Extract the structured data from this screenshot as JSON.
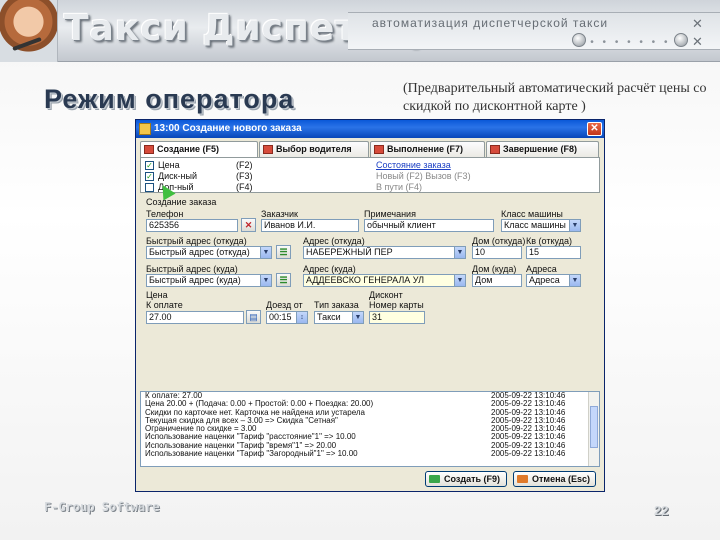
{
  "header": {
    "app_title": "Такси Диспетчер",
    "tagline": "автоматизация диспетчерской такси",
    "dots": "• • • • • • • • •"
  },
  "slide": {
    "mode_title": "Режим оператора",
    "note": "(Предварительный автоматический расчёт цены со скидкой по дисконтной карте )",
    "brand": "F-Group Software",
    "page": "22"
  },
  "window": {
    "title": "13:00 Создание нового заказа",
    "close_glyph": "✕",
    "tabs": [
      {
        "label": "Создание (F5)"
      },
      {
        "label": "Выбор водителя (F6)"
      },
      {
        "label": "Выполнение (F7)"
      },
      {
        "label": "Завершение (F8)"
      }
    ],
    "options": [
      {
        "label": "Цена",
        "key": "(F2)",
        "checked": true
      },
      {
        "label": "Диск-ный",
        "key": "(F3)",
        "checked": true
      },
      {
        "label": "Доп-ный",
        "key": "(F4)",
        "checked": false
      }
    ],
    "links": [
      "Состояние заказа",
      "Новый (F2) Вызов (F3)",
      "В пути (F4)"
    ],
    "group_label": "Создание заказа",
    "fields": {
      "phone_label": "Телефон",
      "phone_value": "625356",
      "customer_label": "Заказчик",
      "customer_value": "Иванов И.И.",
      "note_label": "Примечания",
      "note_value": "обычный клиент",
      "class_label": "Класс машины",
      "class_value": "Класс машины",
      "quick_from_label": "Быстрый адрес (откуда)",
      "quick_from_value": "Быстрый адрес (откуда)",
      "from_label": "Адрес (откуда)",
      "from_value": "НАБЕРЕЖНЫЙ ПЕР",
      "house_label": "Дом (откуда)",
      "house_value": "10",
      "apt_label": "Кв (откуда)",
      "apt_value": "15",
      "quick_to_label": "Быстрый адрес (куда)",
      "quick_to_value": "Быстрый адрес (куда)",
      "to_label": "Адрес (куда)",
      "to_value": "АДДЕЕВСКО ГЕНЕРАЛА УЛ",
      "house_to_label": "Дом (куда)",
      "house_to_value": "Дом",
      "addr2_label": "Адреса",
      "addr2_value": "Адреса",
      "price_label": "Цена",
      "price_sub": "К оплате",
      "price_value": "27.00",
      "arrive_label": "Доезд от",
      "arrive_value": "00:15",
      "type_label": "Тип заказа",
      "type_value": "Такси",
      "discount_label": "Дисконт",
      "card_label": "Номер карты",
      "card_value": "31"
    },
    "log": [
      {
        "text": "К оплате: 27.00",
        "date": "2005-09-22 13:10:46"
      },
      {
        "text": "Цена 20.00 + (Подача: 0.00 + Простой: 0.00 + Поездка: 20.00)",
        "date": "2005-09-22 13:10:46"
      },
      {
        "text": "Скидки по карточке нет. Карточка не найдена или устарела",
        "date": "2005-09-22 13:10:46"
      },
      {
        "text": "Текущая скидка для всех – 3.00 => Скидка \"Сетная\"",
        "date": "2005-09-22 13:10:46"
      },
      {
        "text": "Ограничение по скидке = 3.00",
        "date": "2005-09-22 13:10:46"
      },
      {
        "text": "Использование наценки \"Тариф \"расстояние\"1\" => 10.00",
        "date": "2005-09-22 13:10:46"
      },
      {
        "text": "Использование наценки \"Тариф \"время\"1\" => 20.00",
        "date": "2005-09-22 13:10:46"
      },
      {
        "text": "Использование наценки \"Тариф \"Загородный\"1\" => 10.00",
        "date": "2005-09-22 13:10:46"
      }
    ],
    "create_button": "Создать (F9)",
    "cancel_button": "Отмена (Esc)"
  }
}
